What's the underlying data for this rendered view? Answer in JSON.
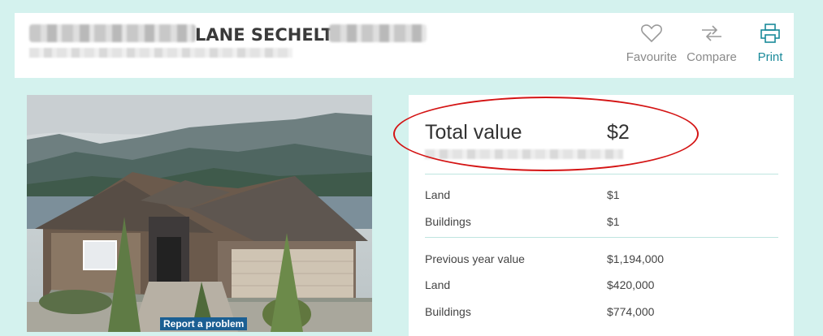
{
  "header": {
    "address_visible": "LANE SECHELT",
    "actions": [
      {
        "label": "Favourite",
        "icon": "heart-icon"
      },
      {
        "label": "Compare",
        "icon": "compare-arrows-icon"
      },
      {
        "label": "Print",
        "icon": "printer-icon"
      }
    ]
  },
  "photo": {
    "report_label": "Report a problem"
  },
  "values": {
    "total_label": "Total value",
    "total_value": "$2",
    "current": [
      {
        "label": "Land",
        "value": "$1"
      },
      {
        "label": "Buildings",
        "value": "$1"
      }
    ],
    "previous": [
      {
        "label": "Previous year value",
        "value": "$1,194,000"
      },
      {
        "label": "Land",
        "value": "$420,000"
      },
      {
        "label": "Buildings",
        "value": "$774,000"
      }
    ]
  },
  "colors": {
    "background": "#d4f2ee",
    "accent": "#1a8a9a",
    "highlight": "#d41414",
    "report_bg": "#1b5f93"
  }
}
